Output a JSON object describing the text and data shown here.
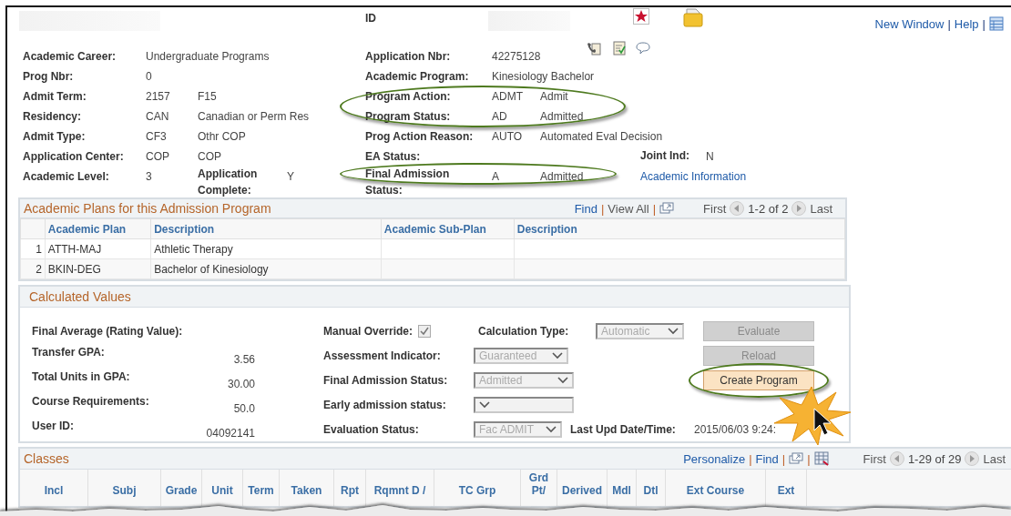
{
  "header": {
    "id_label": "ID",
    "links": [
      "New Window",
      "Help"
    ],
    "separator": "|"
  },
  "fields_left": [
    {
      "label": "Academic Career:",
      "values": [
        "Undergraduate Programs"
      ]
    },
    {
      "label": "Prog Nbr:",
      "values": [
        "0"
      ]
    },
    {
      "label": "Admit Term:",
      "values": [
        "2157",
        "F15"
      ]
    },
    {
      "label": "Residency:",
      "values": [
        "CAN",
        "Canadian or Perm Res"
      ]
    },
    {
      "label": "Admit Type:",
      "values": [
        "CF3",
        "Othr COP"
      ]
    },
    {
      "label": "Application Center:",
      "values": [
        "COP",
        "COP"
      ]
    },
    {
      "label": "Academic Level:",
      "values": [
        "3"
      ],
      "extra": {
        "label": "Application Complete:",
        "value": "Y"
      }
    }
  ],
  "fields_mid": [
    {
      "label": "Application Nbr:",
      "values": [
        "42275128"
      ],
      "circled": false
    },
    {
      "label": "Academic Program:",
      "values": [
        "Kinesiology Bachelor"
      ],
      "circled": false
    },
    {
      "label": "Program Action:",
      "values": [
        "ADMT",
        "Admit"
      ],
      "circled": true
    },
    {
      "label": "Program Status:",
      "values": [
        "AD",
        "Admitted"
      ],
      "circled": true
    },
    {
      "label": "Prog Action Reason:",
      "values": [
        "AUTO",
        "Automated Eval Decision"
      ],
      "circled": false
    },
    {
      "label": "EA Status:",
      "circled": false
    },
    {
      "label": "Final Admission Status:",
      "values": [
        "A",
        "Admitted"
      ],
      "circled": true
    }
  ],
  "joint": {
    "label": "Joint Ind:",
    "value": "N"
  },
  "academic_info_link": "Academic Information",
  "plans": {
    "title": "Academic Plans for this Admission Program",
    "toolbar": {
      "find": "Find",
      "view_all": "View All",
      "separator": "|",
      "first": "First",
      "range": "1-2 of 2",
      "last": "Last"
    },
    "columns": [
      "Academic Plan",
      "Description",
      "Academic Sub-Plan",
      "Description"
    ],
    "rows": [
      {
        "num": "1",
        "plan": "ATTH-MAJ",
        "description": "Athletic Therapy"
      },
      {
        "num": "2",
        "plan": "BKIN-DEG",
        "description": "Bachelor of Kinesiology"
      }
    ]
  },
  "calc": {
    "title": "Calculated Values",
    "left": [
      {
        "label": "Final Average (Rating Value):"
      },
      {
        "label": "Transfer GPA:",
        "value": "3.56"
      },
      {
        "label": "Total Units in GPA:",
        "value": "30.00"
      },
      {
        "label": "Course Requirements:",
        "value": "50.0"
      },
      {
        "label": "User ID:",
        "value": "04092141"
      }
    ],
    "manual_override": {
      "label": "Manual Override:",
      "checked": true
    },
    "calc_type": {
      "label": "Calculation Type:",
      "value": "Automatic"
    },
    "selects": [
      {
        "label": "Assessment Indicator:",
        "value": "Guaranteed"
      },
      {
        "label": "Final Admission Status:",
        "value": "Admitted"
      },
      {
        "label": "Early admission status:"
      }
    ],
    "eval_status": {
      "label": "Evaluation Status:",
      "value": "Fac ADMIT"
    },
    "last_upd": {
      "label": "Last Upd Date/Time:",
      "value": "2015/06/03  9:24:"
    },
    "buttons": [
      {
        "label": "Evaluate",
        "disabled": true,
        "circled": false
      },
      {
        "label": "Reload",
        "disabled": true,
        "circled": false
      },
      {
        "label": "Create Program",
        "disabled": false,
        "circled": true
      }
    ]
  },
  "classes": {
    "title": "Classes",
    "toolbar": {
      "personalize": "Personalize",
      "find": "Find",
      "separator": "|",
      "first": "First",
      "range": "1-29 of 29",
      "last": "Last"
    },
    "columns": [
      "Incl",
      "Subj",
      "Grade",
      "Unit",
      "Term",
      "Taken",
      "Rpt",
      "Rqmnt D /",
      "TC Grp",
      "Grd Pt/",
      "Derived",
      "Mdl",
      "Dtl",
      "Ext Course",
      "Ext"
    ]
  }
}
